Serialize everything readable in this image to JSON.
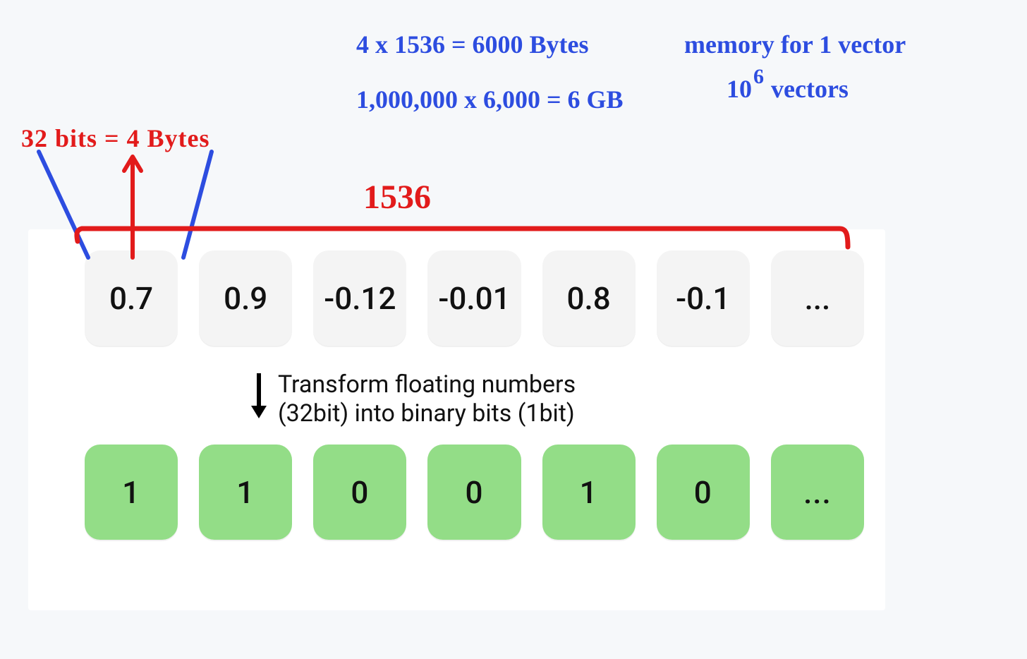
{
  "annotations": {
    "bits_per_float": "32 bits = 4 Bytes",
    "calc_per_vector": "4 x 1536 = 6000 Bytes",
    "calc_all_vectors": "1,000,000 x 6,000 = 6 GB",
    "memory_label": "memory for 1 vector",
    "vectors_base": "10",
    "vectors_exp": "6",
    "vectors_tail": "vectors",
    "dimension_label": "1536"
  },
  "diagram": {
    "float_row": [
      "0.7",
      "0.9",
      "-0.12",
      "-0.01",
      "0.8",
      "-0.1",
      "..."
    ],
    "bit_row": [
      "1",
      "1",
      "0",
      "0",
      "1",
      "0",
      "..."
    ],
    "transform_caption_l1": "Transform floating numbers",
    "transform_caption_l2": "(32bit) into binary bits (1bit)"
  },
  "colors": {
    "blue": "#2d4de0",
    "red": "#e21b1b",
    "float_cell": "#f4f4f4",
    "bit_cell": "#93dd87"
  }
}
